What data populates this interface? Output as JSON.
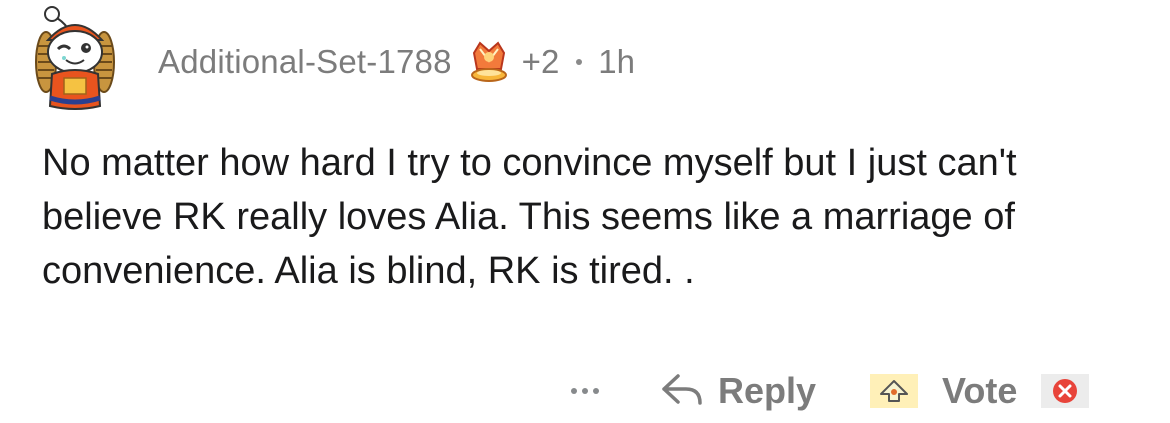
{
  "comment": {
    "username": "Additional-Set-1788",
    "award_count": "+2",
    "age": "1h",
    "body": "No matter how hard I try to convince myself but I just can't believe RK really loves Alia. This seems like a marriage of convenience. Alia is blind, RK is tired. ."
  },
  "actions": {
    "reply_label": "Reply",
    "vote_label": "Vote"
  },
  "icons": {
    "avatar": "snoo-avatar-icon",
    "award": "award-icon",
    "more": "more-options-icon",
    "reply": "reply-arrow-icon",
    "upvote": "upvote-icon",
    "downvote": "downvote-icon"
  },
  "colors": {
    "meta_text": "#7c7c7c",
    "body_text": "#1a1a1b",
    "avatar_accent": "#e8541e"
  }
}
